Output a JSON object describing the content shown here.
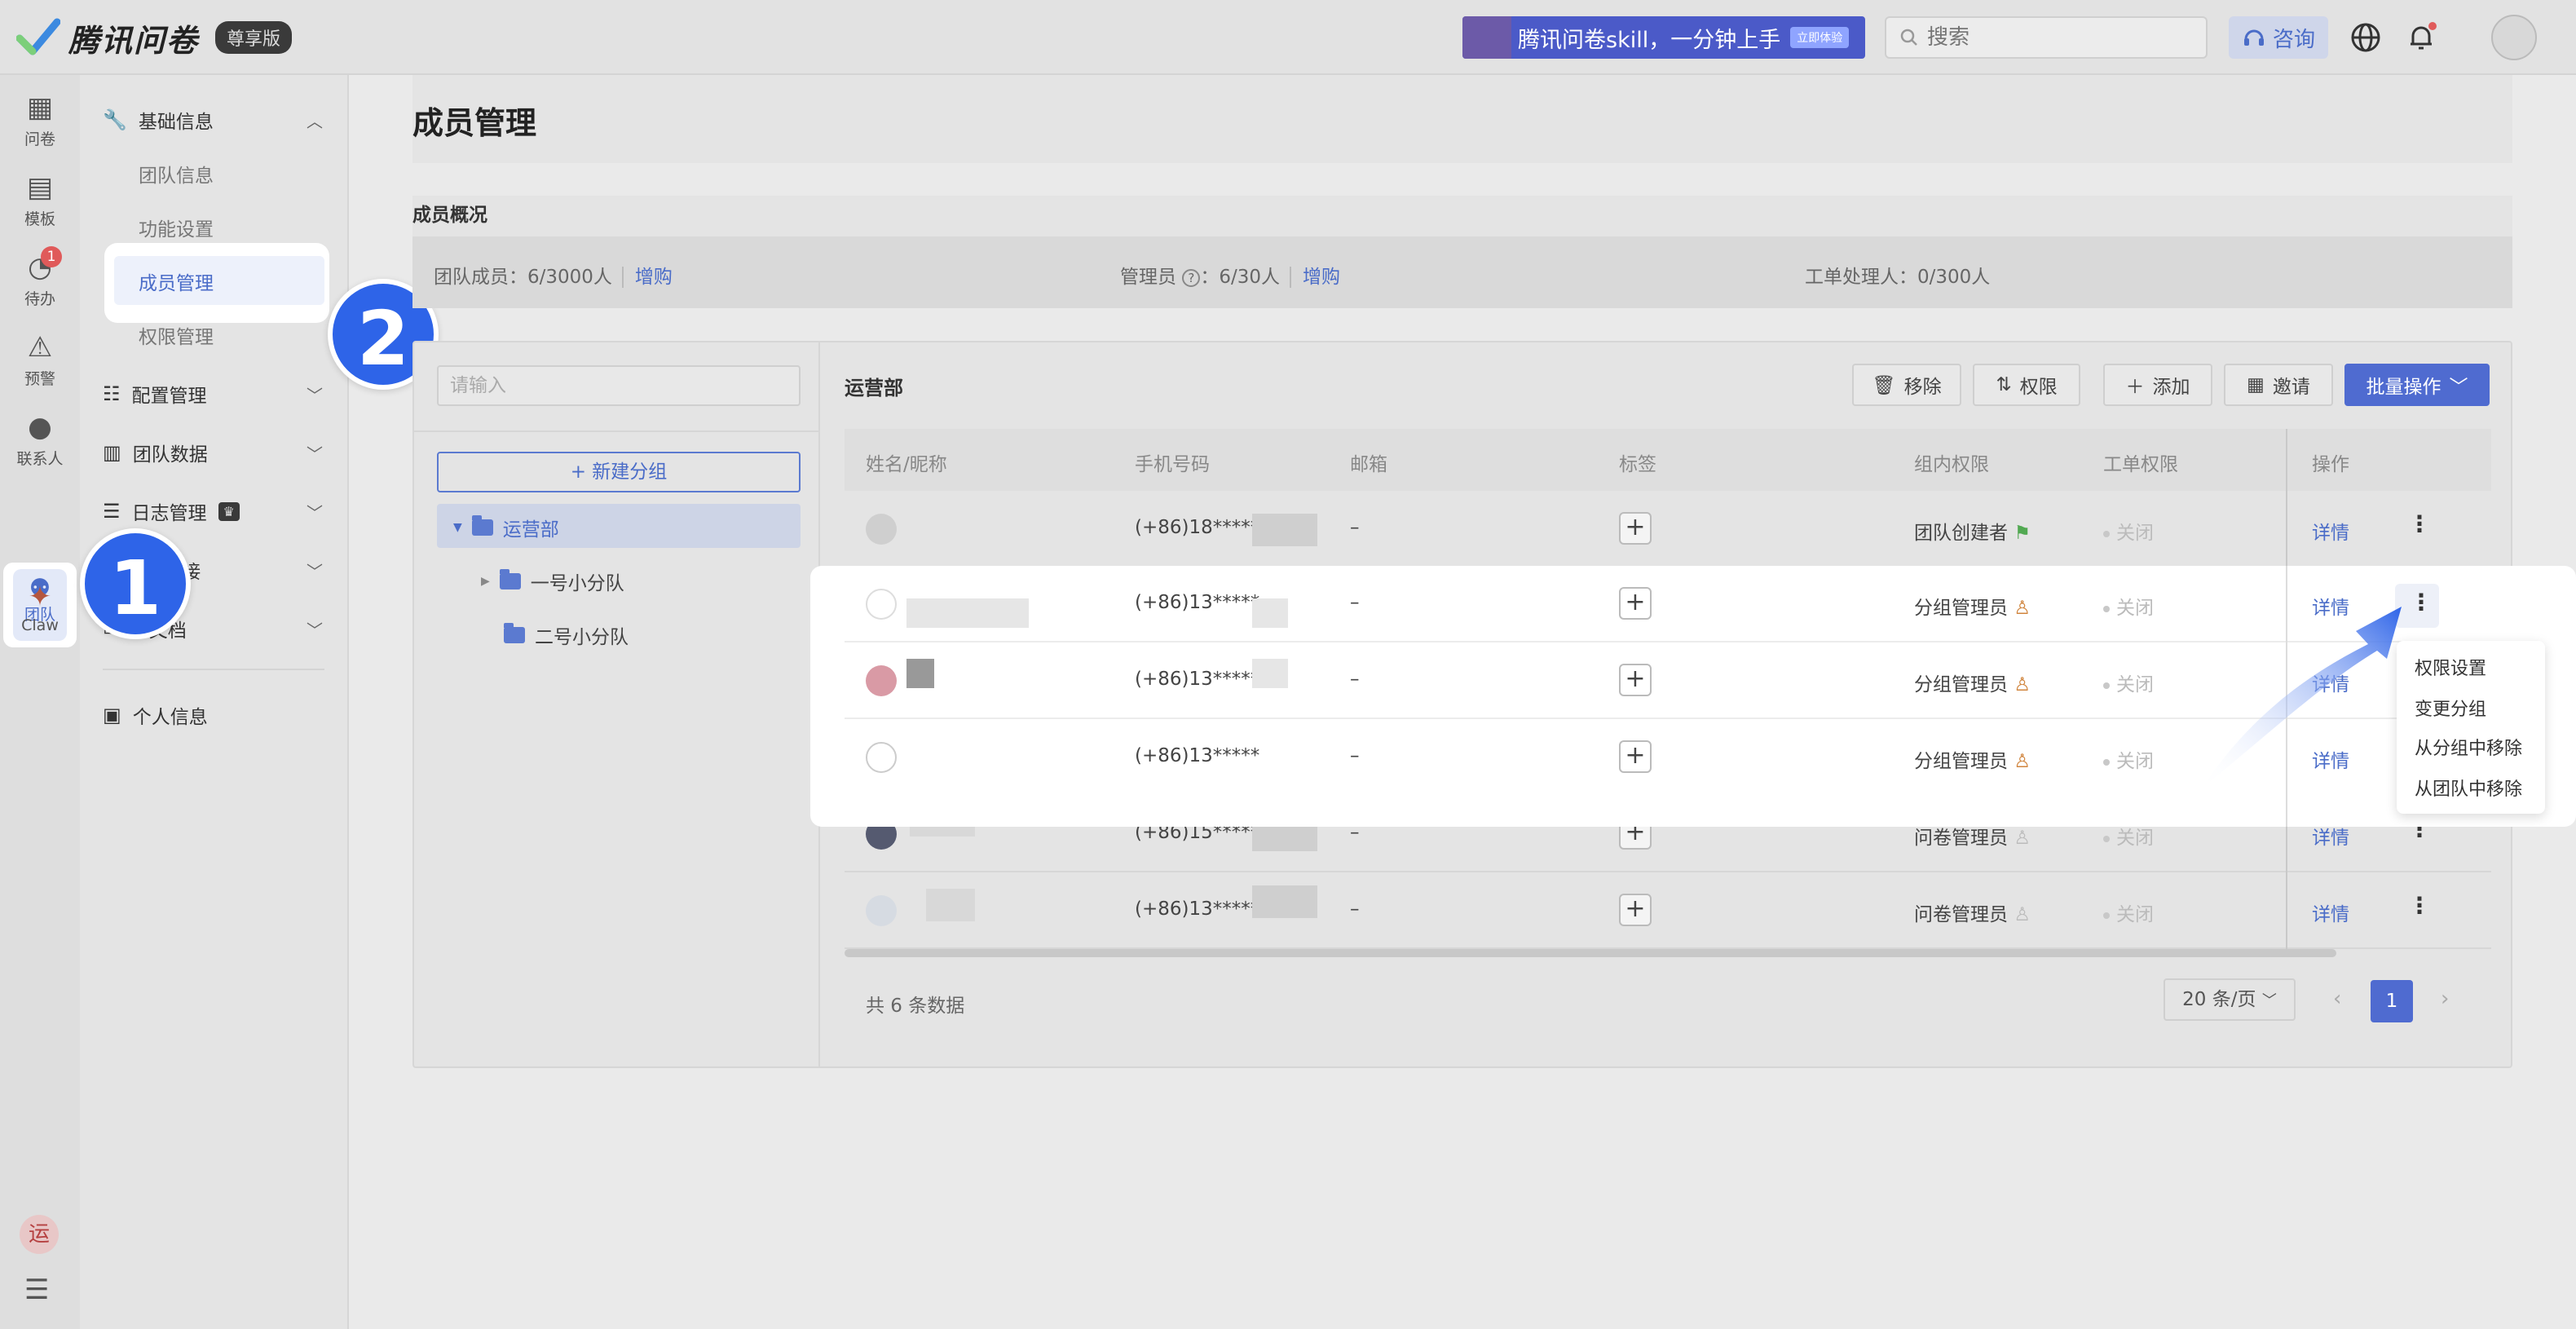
{
  "header": {
    "app_name": "腾讯问卷",
    "edition": "尊享版",
    "banner_text": "腾讯问卷skill，一分钟上手",
    "banner_tag": "立即体验",
    "search_placeholder": "搜索",
    "consult_label": "咨询"
  },
  "rail": {
    "items": [
      {
        "label": "问卷",
        "icon": "grid-icon"
      },
      {
        "label": "模板",
        "icon": "template-icon"
      },
      {
        "label": "待办",
        "icon": "todo-icon",
        "badge": "1"
      },
      {
        "label": "预警",
        "icon": "warning-icon"
      },
      {
        "label": "联系人",
        "icon": "contact-icon"
      },
      {
        "label": "团队",
        "icon": "team-icon"
      },
      {
        "label": "Claw",
        "icon": "claw-icon"
      }
    ],
    "user_initial": "运"
  },
  "nav": {
    "basic_info": "基础信息",
    "sub_items": [
      "团队信息",
      "功能设置",
      "成员管理",
      "权限管理"
    ],
    "config": "配置管理",
    "team_data": "团队数据",
    "log": "日志管理",
    "integration": "对接",
    "docs": "文档",
    "personal": "个人信息"
  },
  "steps": [
    "1",
    "2"
  ],
  "page": {
    "title": "成员管理",
    "overview_title": "成员概况",
    "members_label": "团队成员：6/3000人",
    "members_buy": "增购",
    "admins_label": "管理员",
    "admins_value": "：6/30人",
    "admins_buy": "增购",
    "handlers_label": "工单处理人：0/300人"
  },
  "tree": {
    "placeholder": "请输入",
    "new_group": "+ 新建分组",
    "root": "运营部",
    "children": [
      "一号小分队",
      "二号小分队"
    ]
  },
  "table": {
    "dept_name": "运营部",
    "buttons": {
      "remove": "移除",
      "permission": "权限",
      "add": "添加",
      "invite": "邀请",
      "batch": "批量操作"
    },
    "columns": [
      "姓名/昵称",
      "手机号码",
      "邮箱",
      "标签",
      "组内权限",
      "工单权限",
      "操作"
    ],
    "rows": [
      {
        "phone": "(+86)18*****",
        "email": "–",
        "role": "团队创建者",
        "ticket": "关闭",
        "action": "详情"
      },
      {
        "phone": "(+86)13*****",
        "email": "–",
        "role": "分组管理员",
        "ticket": "关闭",
        "action": "详情"
      },
      {
        "phone": "(+86)13*****",
        "email": "–",
        "role": "分组管理员",
        "ticket": "关闭",
        "action": "详情"
      },
      {
        "phone": "(+86)13*****",
        "email": "–",
        "role": "分组管理员",
        "ticket": "关闭",
        "action": "详情"
      },
      {
        "phone": "(+86)15*****",
        "email": "–",
        "role": "问卷管理员",
        "ticket": "关闭",
        "action": "详情"
      },
      {
        "phone": "(+86)13*****",
        "email": "–",
        "role": "问卷管理员",
        "ticket": "关闭",
        "action": "详情"
      }
    ],
    "total": "共 6 条数据",
    "page_size": "20 条/页",
    "current_page": "1"
  },
  "dropdown": [
    "权限设置",
    "变更分组",
    "从分组中移除",
    "从团队中移除"
  ],
  "colors": {
    "primary": "#4f6bd0",
    "step": "#2e64e8",
    "badge": "#e05a5a"
  }
}
